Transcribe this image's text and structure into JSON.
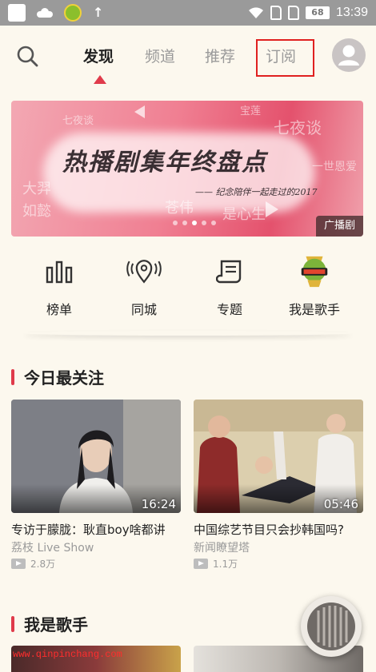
{
  "status_bar": {
    "battery": "68",
    "time": "13:39"
  },
  "nav": {
    "tabs": [
      {
        "label": "发现",
        "active": true
      },
      {
        "label": "频道",
        "active": false
      },
      {
        "label": "推荐",
        "active": false
      },
      {
        "label": "订阅",
        "active": false
      }
    ],
    "icons": {
      "search": "search-icon",
      "avatar": "user-avatar-icon"
    },
    "accent_color": "#e03b4b"
  },
  "banner": {
    "title": "热播剧集年终盘点",
    "subtitle": "—— 纪念陪伴一起走过的2017",
    "faint_texts": [
      "七夜谈",
      "宝莲",
      "一世恩爱",
      "大羿",
      "如懿",
      "苍伟",
      "是心生"
    ],
    "tag": "广播剧",
    "page_count": 5,
    "active_page": 2
  },
  "categories": [
    {
      "label": "榜单",
      "icon": "bar-chart-icon"
    },
    {
      "label": "同城",
      "icon": "location-pin-icon"
    },
    {
      "label": "专题",
      "icon": "scroll-icon"
    },
    {
      "label": "我是歌手",
      "icon": "singer-logo-icon"
    }
  ],
  "sections": [
    {
      "title": "今日最关注",
      "items": [
        {
          "title": "专访于朦胧：耿直boy啥都讲",
          "source": "荔枝 Live Show",
          "plays": "2.8万",
          "duration": "16:24"
        },
        {
          "title": "中国综艺节目只会抄韩国吗?",
          "source": "新闻瞭望塔",
          "plays": "1.1万",
          "duration": "05:46"
        }
      ]
    },
    {
      "title": "我是歌手",
      "items": []
    }
  ],
  "watermark": "www.qinpinchang.com"
}
